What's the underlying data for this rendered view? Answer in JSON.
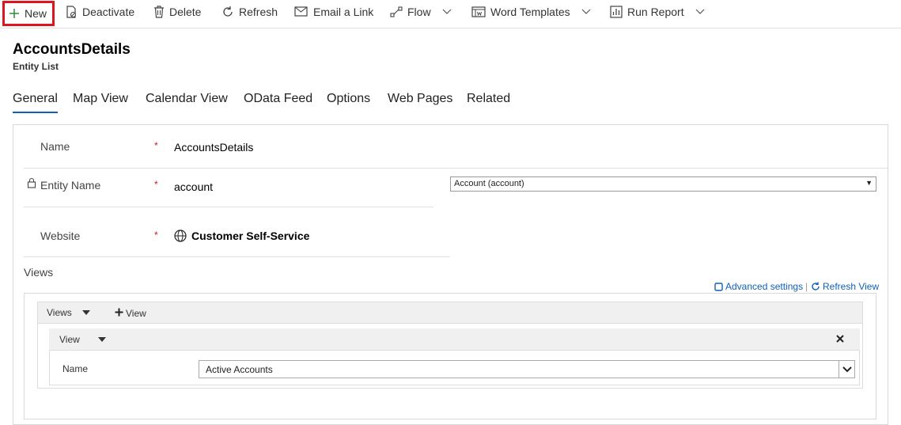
{
  "toolbar": {
    "new": "New",
    "deactivate": "Deactivate",
    "delete": "Delete",
    "refresh": "Refresh",
    "email_link": "Email a Link",
    "flow": "Flow",
    "word_templates": "Word Templates",
    "run_report": "Run Report"
  },
  "header": {
    "title": "AccountsDetails",
    "subtitle": "Entity List"
  },
  "tabs": [
    {
      "label": "General"
    },
    {
      "label": "Map View"
    },
    {
      "label": "Calendar View"
    },
    {
      "label": "OData Feed"
    },
    {
      "label": "Options"
    },
    {
      "label": "Web Pages"
    },
    {
      "label": "Related"
    }
  ],
  "form": {
    "name_label": "Name",
    "name_value": "AccountsDetails",
    "entity_label": "Entity Name",
    "entity_value": "account",
    "entity_select": "Account (account)",
    "website_label": "Website",
    "website_value": "Customer Self-Service",
    "required_mark": "*",
    "views_label": "Views"
  },
  "views": {
    "advanced_settings": "Advanced settings",
    "separator": "|",
    "refresh_view": "Refresh View",
    "bar_label": "Views",
    "add_view": "View",
    "card_label": "View",
    "name_label": "Name",
    "name_value": "Active Accounts"
  },
  "colors": {
    "accent": "#1160b7",
    "highlight": "#e0141e",
    "required": "#c0211f"
  }
}
